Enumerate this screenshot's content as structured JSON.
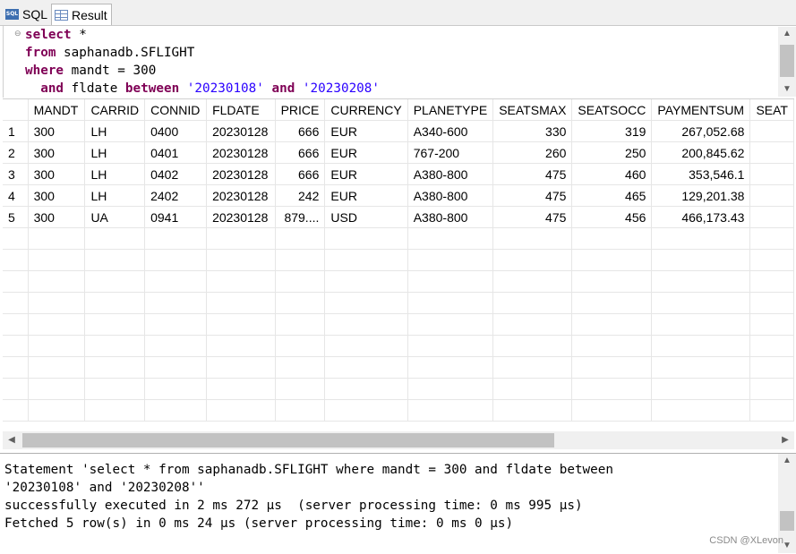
{
  "tabs": [
    {
      "label": "SQL",
      "icon": "sql-icon"
    },
    {
      "label": "Result",
      "icon": "grid-icon"
    }
  ],
  "editor": {
    "lines": [
      {
        "indent": "",
        "parts": [
          {
            "t": "kw",
            "v": "select"
          },
          {
            "t": "txt",
            "v": " *"
          }
        ]
      },
      {
        "indent": "",
        "parts": [
          {
            "t": "kw",
            "v": "from"
          },
          {
            "t": "txt",
            "v": " saphanadb.SFLIGHT"
          }
        ]
      },
      {
        "indent": "",
        "parts": [
          {
            "t": "kw",
            "v": "where"
          },
          {
            "t": "txt",
            "v": " mandt = 300"
          }
        ]
      },
      {
        "indent": "  ",
        "parts": [
          {
            "t": "kw",
            "v": "and"
          },
          {
            "t": "txt",
            "v": " fldate "
          },
          {
            "t": "kw",
            "v": "between"
          },
          {
            "t": "txt",
            "v": " "
          },
          {
            "t": "str",
            "v": "'20230108'"
          },
          {
            "t": "txt",
            "v": " "
          },
          {
            "t": "kw",
            "v": "and"
          },
          {
            "t": "txt",
            "v": " "
          },
          {
            "t": "str",
            "v": "'20230208'"
          }
        ]
      }
    ]
  },
  "result": {
    "columns": [
      "",
      "MANDT",
      "CARRID",
      "CONNID",
      "FLDATE",
      "PRICE",
      "CURRENCY",
      "PLANETYPE",
      "SEATSMAX",
      "SEATSOCC",
      "PAYMENTSUM",
      "SEAT"
    ],
    "rows": [
      [
        "1",
        "300",
        "LH",
        "0400",
        "20230128",
        "666",
        "EUR",
        "A340-600",
        "330",
        "319",
        "267,052.68",
        ""
      ],
      [
        "2",
        "300",
        "LH",
        "0401",
        "20230128",
        "666",
        "EUR",
        "767-200",
        "260",
        "250",
        "200,845.62",
        ""
      ],
      [
        "3",
        "300",
        "LH",
        "0402",
        "20230128",
        "666",
        "EUR",
        "A380-800",
        "475",
        "460",
        "353,546.1",
        ""
      ],
      [
        "4",
        "300",
        "LH",
        "2402",
        "20230128",
        "242",
        "EUR",
        "A380-800",
        "475",
        "465",
        "129,201.38",
        ""
      ],
      [
        "5",
        "300",
        "UA",
        "0941",
        "20230128",
        "879....",
        "USD",
        "A380-800",
        "475",
        "456",
        "466,173.43",
        ""
      ]
    ],
    "empty_rows": 9
  },
  "console": {
    "lines": [
      "Statement 'select * from saphanadb.SFLIGHT where mandt = 300 and fldate between",
      "'20230108' and '20230208''",
      "successfully executed in 2 ms 272 µs  (server processing time: 0 ms 995 µs)",
      "Fetched 5 row(s) in 0 ms 24 µs (server processing time: 0 ms 0 µs)"
    ]
  },
  "watermark": "CSDN @XLevon",
  "colors": {
    "keyword": "#7f0055",
    "string": "#2a00ff"
  }
}
